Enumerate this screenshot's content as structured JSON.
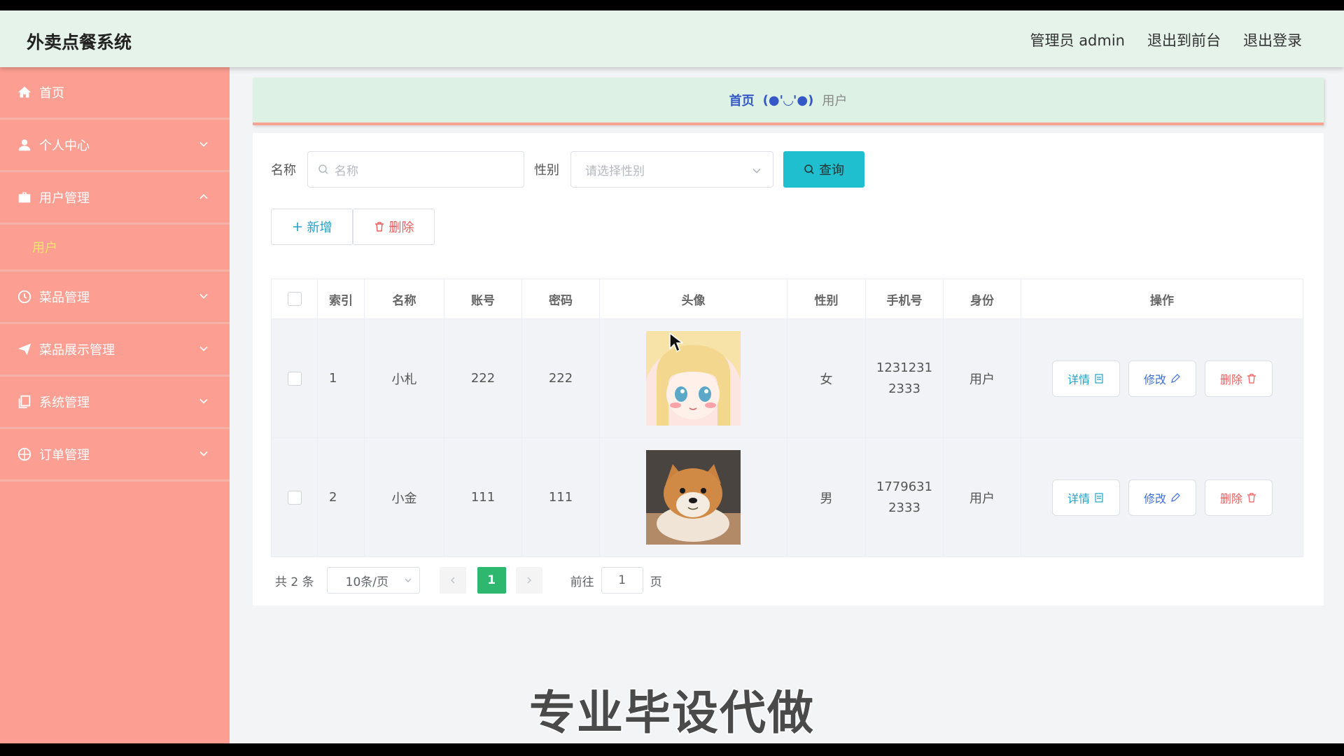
{
  "app": {
    "title": "外卖点餐系统"
  },
  "topnav": {
    "admin": "管理员 admin",
    "to_front": "退出到前台",
    "logout": "退出登录"
  },
  "sidebar": {
    "items": [
      {
        "label": "首页",
        "icon": "home-icon"
      },
      {
        "label": "个人中心",
        "icon": "user-icon"
      },
      {
        "label": "用户管理",
        "icon": "briefcase-icon",
        "expanded": true,
        "sub": [
          "用户"
        ]
      },
      {
        "label": "菜品管理",
        "icon": "clock-icon"
      },
      {
        "label": "菜品展示管理",
        "icon": "send-icon"
      },
      {
        "label": "系统管理",
        "icon": "copy-icon"
      },
      {
        "label": "订单管理",
        "icon": "compass-icon"
      }
    ]
  },
  "breadcrumb": {
    "home": "首页",
    "sep": "(●'◡'●)",
    "current": "用户"
  },
  "filters": {
    "name_label": "名称",
    "name_placeholder": "名称",
    "gender_label": "性别",
    "gender_placeholder": "请选择性别",
    "query": "查询"
  },
  "actions": {
    "add": "新增",
    "delete": "删除"
  },
  "table": {
    "headers": [
      "索引",
      "名称",
      "账号",
      "密码",
      "头像",
      "性别",
      "手机号",
      "身份",
      "操作"
    ],
    "rows": [
      {
        "index": "1",
        "name": "小札",
        "account": "222",
        "password": "222",
        "avatar": "anime-girl-avatar",
        "gender": "女",
        "phone_l1": "1231231",
        "phone_l2": "2333",
        "role": "用户"
      },
      {
        "index": "2",
        "name": "小金",
        "account": "111",
        "password": "111",
        "avatar": "shiba-dog-avatar",
        "gender": "男",
        "phone_l1": "1779631",
        "phone_l2": "2333",
        "role": "用户"
      }
    ],
    "ops": {
      "detail": "详情",
      "edit": "修改",
      "delete": "删除"
    }
  },
  "pagination": {
    "total": "共 2 条",
    "page_size": "10条/页",
    "current": "1",
    "goto": "前往",
    "goto_value": "1",
    "page_unit": "页"
  },
  "caption": "专业毕设代做",
  "colors": {
    "sidebar": "#fc9f92",
    "header": "#e6f3ea",
    "accent": "#1fbfcf",
    "active_page": "#2db76f",
    "danger": "#f05a5a"
  }
}
